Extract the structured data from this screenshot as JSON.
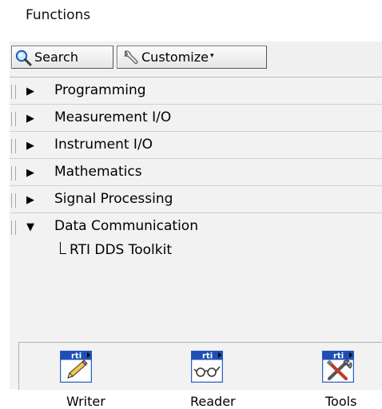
{
  "window": {
    "title": "Functions"
  },
  "toolbar": {
    "search_label": "Search",
    "customize_label": "Customize",
    "customize_caret": "▾"
  },
  "categories": [
    {
      "label": "Programming",
      "expanded": false
    },
    {
      "label": "Measurement I/O",
      "expanded": false
    },
    {
      "label": "Instrument I/O",
      "expanded": false
    },
    {
      "label": "Mathematics",
      "expanded": false
    },
    {
      "label": "Signal Processing",
      "expanded": false
    },
    {
      "label": "Data Communication",
      "expanded": true
    }
  ],
  "expanded_glyphs": {
    "collapsed": "▶",
    "expanded": "▼"
  },
  "subpalette": {
    "label": "RTI DDS Toolkit"
  },
  "vis": [
    {
      "label": "Writer",
      "badge": "rti",
      "icon": "pencil-icon"
    },
    {
      "label": "Reader",
      "badge": "rti",
      "icon": "glasses-icon"
    },
    {
      "label": "Tools",
      "badge": "rti",
      "icon": "tools-icon"
    }
  ],
  "colors": {
    "vi_header": "#1f4fb4",
    "vi_border": "#2a62c9",
    "palette_bg": "#f2f2f2"
  }
}
